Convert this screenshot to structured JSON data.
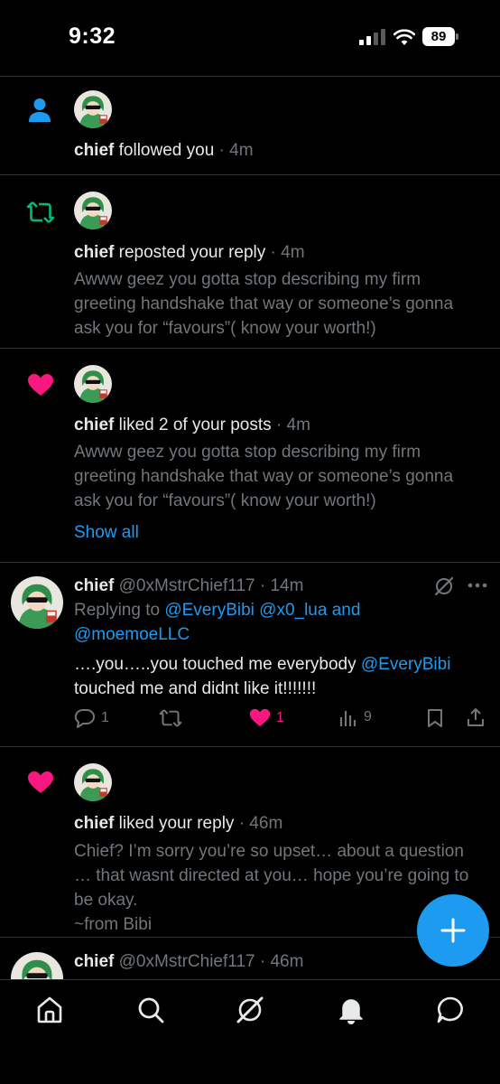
{
  "status_bar": {
    "time": "9:32",
    "battery": "89"
  },
  "notifications": [
    {
      "type": "follow",
      "user": "chief",
      "action": " followed you",
      "time": " · 4m"
    },
    {
      "type": "repost",
      "user": "chief",
      "action": " reposted your reply",
      "time": " · 4m",
      "text_lines": [
        "Awww geez you gotta stop describing my firm",
        "greeting handshake that way or someone’s gonna",
        "ask you for “favours”( know your worth!)"
      ]
    },
    {
      "type": "like",
      "user": "chief",
      "action": " liked 2 of your posts",
      "time": " · 4m",
      "text_lines": [
        "Awww geez you gotta stop describing my firm",
        "greeting handshake that way or someone’s gonna",
        "ask you for “favours”( know your worth!)"
      ],
      "show_all": "Show all"
    }
  ],
  "reply_post": {
    "name": "chief",
    "handle": " @0xMstrChief117",
    "time": " · 14m",
    "replying_prefix": "Replying to ",
    "replying_mentions_1": "@EveryBibi @x0_lua",
    "replying_and": " and",
    "replying_mentions_2": "@moemoeLLC",
    "text_part1": "….you…..you touched me everybody ",
    "text_mention": "@EveryBibi",
    "text_line2": "touched me and didnt like it!!!!!!!",
    "replies": "1",
    "likes": "1",
    "views": "9"
  },
  "like_notification_2": {
    "user": "chief",
    "action": " liked your reply",
    "time": " · 46m",
    "text_lines": [
      "Chief? I’m sorry you’re so upset… about a question",
      "… that wasnt directed at you… hope you’re going to",
      "be  okay.",
      "~from Bibi"
    ]
  },
  "partial_post": {
    "name": "chief",
    "handle": " @0xMstrChief117",
    "time": " · 46m"
  },
  "colors": {
    "accent": "#1d9bf0",
    "like": "#f91880",
    "repost": "#00ba7c",
    "background": "#000000"
  },
  "icons": {
    "home": "home-icon",
    "search": "search-icon",
    "grok": "grok-icon",
    "notifications": "bell-icon",
    "messages": "chat-icon"
  }
}
